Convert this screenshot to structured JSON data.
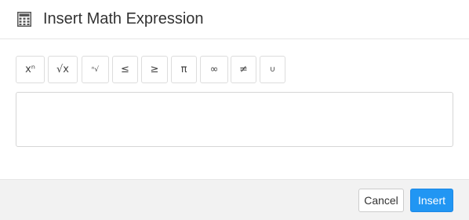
{
  "dialog": {
    "title": "Insert Math Expression",
    "icon": "calculator-icon"
  },
  "toolbar": {
    "buttons": [
      {
        "name": "superscript",
        "label": "xⁿ"
      },
      {
        "name": "square-root",
        "label": "√x"
      },
      {
        "name": "nth-root",
        "label": "ⁿ√"
      },
      {
        "name": "less-equal",
        "label": "≤"
      },
      {
        "name": "greater-equal",
        "label": "≥"
      },
      {
        "name": "pi",
        "label": "π"
      },
      {
        "name": "infinity",
        "label": "∞"
      },
      {
        "name": "not-equal",
        "label": "≠"
      },
      {
        "name": "union",
        "label": "∪"
      }
    ]
  },
  "editor": {
    "value": ""
  },
  "footer": {
    "cancel_label": "Cancel",
    "insert_label": "Insert",
    "insert_color": "#2196f3"
  }
}
